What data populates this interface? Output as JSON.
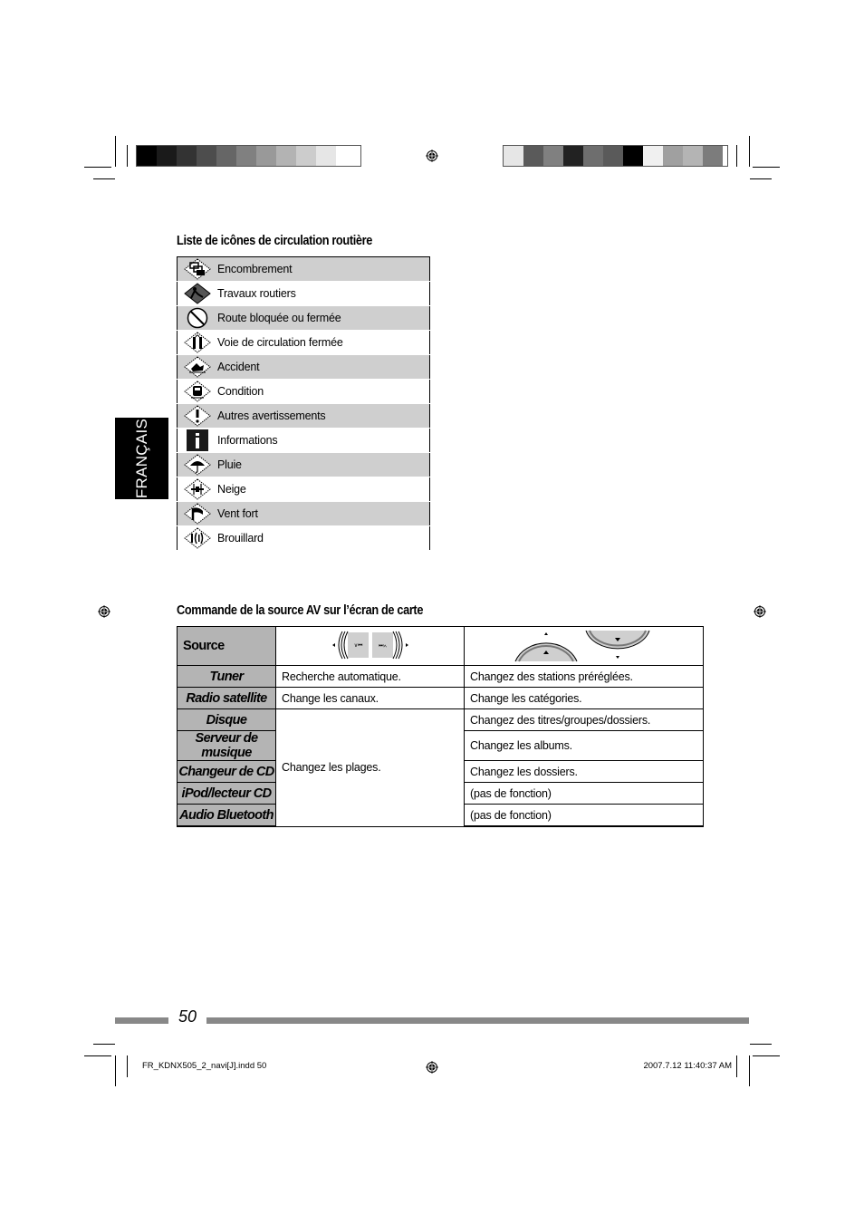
{
  "color_bars": {
    "left": [
      "#000000",
      "#1a1a1a",
      "#333333",
      "#4d4d4d",
      "#666666",
      "#808080",
      "#999999",
      "#b3b3b3",
      "#cccccc",
      "#e6e6e6",
      "#ffffff"
    ],
    "right": [
      "#e6e6e6",
      "#5a5a5a",
      "#808080",
      "#222222",
      "#6e6e6e",
      "#5a5a5a",
      "#000000",
      "#f0f0f0",
      "#a0a0a0",
      "#b4b4b4",
      "#7c7c7c"
    ]
  },
  "language_tab": "FRANÇAIS",
  "traffic_icons": {
    "title": "Liste de icônes de circulation routière",
    "items": [
      {
        "icon": "congestion-icon",
        "label": "Encombrement"
      },
      {
        "icon": "roadworks-icon",
        "label": "Travaux routiers"
      },
      {
        "icon": "road-closed-icon",
        "label": "Route bloquée ou fermée"
      },
      {
        "icon": "lane-closed-icon",
        "label": "Voie de circulation fermée"
      },
      {
        "icon": "accident-icon",
        "label": "Accident"
      },
      {
        "icon": "condition-icon",
        "label": "Condition"
      },
      {
        "icon": "warning-icon",
        "label": "Autres avertissements"
      },
      {
        "icon": "info-icon",
        "label": "Informations"
      },
      {
        "icon": "rain-icon",
        "label": "Pluie"
      },
      {
        "icon": "snow-icon",
        "label": "Neige"
      },
      {
        "icon": "wind-icon",
        "label": "Vent fort"
      },
      {
        "icon": "fog-icon",
        "label": "Brouillard"
      }
    ]
  },
  "av_control": {
    "title": "Commande de la source AV sur l’écran de carte",
    "header": {
      "source": "Source",
      "col2_icon": "skip-buttons-icon",
      "col3_icon": "control-dial-icon"
    },
    "rows": [
      {
        "source": "Tuner",
        "col2": "Recherche automatique.",
        "col3": "Changez des stations préréglées."
      },
      {
        "source": "Radio satellite",
        "col2": "Change les canaux.",
        "col3": "Change les catégories."
      },
      {
        "source": "Disque",
        "col2": "Changez les plages.",
        "col3": "Changez des titres/groupes/dossiers."
      },
      {
        "source": "Serveur de musique",
        "col3": "Changez les albums."
      },
      {
        "source": "Changeur de CD",
        "col3": "Changez les dossiers."
      },
      {
        "source": "iPod/lecteur CD",
        "col3": "(pas de fonction)"
      },
      {
        "source": "Audio Bluetooth",
        "col3": "(pas de fonction)"
      }
    ]
  },
  "page_number": "50",
  "footer": {
    "file": "FR_KDNX505_2_navi[J].indd   50",
    "timestamp": "2007.7.12   11:40:37 AM"
  }
}
